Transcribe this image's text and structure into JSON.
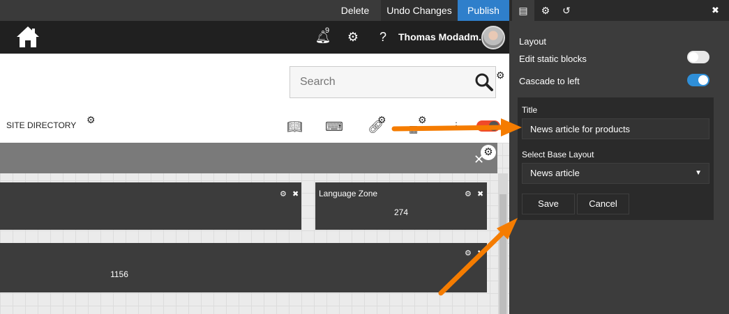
{
  "topbar": {
    "delete_label": "Delete",
    "undo_label": "Undo Changes",
    "publish_label": "Publish"
  },
  "header": {
    "notification_count": "9",
    "user_name": "Thomas Modadm...",
    "help_label": "?"
  },
  "nav": {
    "search_placeholder": "Search",
    "site_directory": "SITE DIRECTORY"
  },
  "zones": [
    {
      "title": "",
      "value": ""
    },
    {
      "title": "Language Zone",
      "value": "274"
    },
    {
      "title": "",
      "value": "1156"
    }
  ],
  "panel": {
    "section_title": "Layout",
    "edit_static_label": "Edit static blocks",
    "edit_static_on": false,
    "cascade_label": "Cascade to left",
    "cascade_on": true,
    "form": {
      "title_label": "Title",
      "title_value": "News article for products",
      "base_layout_label": "Select Base Layout",
      "base_layout_value": "News article",
      "save_label": "Save",
      "cancel_label": "Cancel"
    }
  },
  "colors": {
    "publish": "#2f7fcb",
    "annotation_arrow": "#f57c00",
    "toggle_on": "#2f8fd8"
  }
}
